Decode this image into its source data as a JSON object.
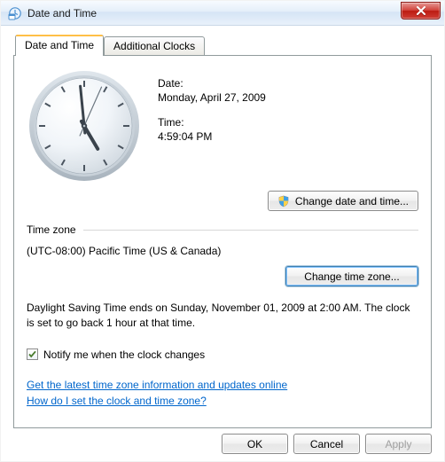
{
  "window": {
    "title": "Date and Time"
  },
  "tabs": [
    {
      "label": "Date and Time"
    },
    {
      "label": "Additional Clocks"
    }
  ],
  "info": {
    "date_label": "Date:",
    "date_value": "Monday, April 27, 2009",
    "time_label": "Time:",
    "time_value": "4:59:04 PM"
  },
  "buttons": {
    "change_date_time": "Change date and time...",
    "change_time_zone": "Change time zone...",
    "ok": "OK",
    "cancel": "Cancel",
    "apply": "Apply"
  },
  "groups": {
    "time_zone_header": "Time zone"
  },
  "time_zone": {
    "display": "(UTC-08:00) Pacific Time (US & Canada)"
  },
  "dst": {
    "text": "Daylight Saving Time ends on Sunday, November 01, 2009 at 2:00 AM. The clock is set to go back 1 hour at that time."
  },
  "checkbox": {
    "notify_label": "Notify me when the clock changes",
    "checked": true
  },
  "links": {
    "update_info": "Get the latest time zone information and updates online",
    "how_to": "How do I set the clock and time zone?"
  },
  "clock": {
    "hour": 4,
    "minute": 59,
    "second": 4
  }
}
